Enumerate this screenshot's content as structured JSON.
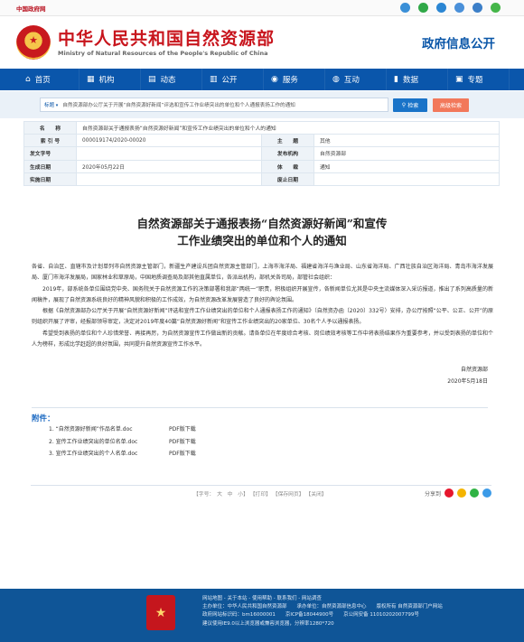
{
  "topbar": {
    "gov_link": "中国政府网",
    "icons": [
      {
        "name": "weibo-icon",
        "color": "#3a8fd7"
      },
      {
        "name": "wechat-icon",
        "color": "#30a848"
      },
      {
        "name": "app-icon",
        "color": "#2b86d3"
      },
      {
        "name": "mail-icon",
        "color": "#4a90d9"
      },
      {
        "name": "search-icon",
        "color": "#3c7fc8"
      },
      {
        "name": "message-icon",
        "color": "#45b649"
      }
    ]
  },
  "header": {
    "title_cn": "中华人民共和国自然资源部",
    "title_en": "Ministry of Natural Resources of the People's Republic of China",
    "section": "政府信息公开"
  },
  "nav": [
    {
      "icon": "home-icon",
      "glyph": "⌂",
      "label": "首页"
    },
    {
      "icon": "building-icon",
      "glyph": "▦",
      "label": "机构"
    },
    {
      "icon": "news-icon",
      "glyph": "▤",
      "label": "动态"
    },
    {
      "icon": "document-icon",
      "glyph": "▥",
      "label": "公开"
    },
    {
      "icon": "service-icon",
      "glyph": "◉",
      "label": "服务"
    },
    {
      "icon": "interact-icon",
      "glyph": "◍",
      "label": "互动"
    },
    {
      "icon": "data-icon",
      "glyph": "▮",
      "label": "数据"
    },
    {
      "icon": "topic-icon",
      "glyph": "▣",
      "label": "专题"
    }
  ],
  "search": {
    "scope": "标题",
    "query": "自然资源部办公厅关于开展“自然资源好新闻”评选和宣传工作业绩突出的单位和个人通报表扬工作的通知",
    "search_label": "检索",
    "advanced_label": "高级检索"
  },
  "info": {
    "name_label": "名　　称",
    "name_value": "自然资源部关于通报表扬“自然资源好新闻”和宣传工作业绩突出的单位和个人的通知",
    "index_label": "索 引 号",
    "index_value": "000019174/2020-00020",
    "topic_label": "主　　题",
    "topic_value": "其他",
    "doc_no_label": "发文字号",
    "doc_no_value": "",
    "issuer_label": "发布机构",
    "issuer_value": "自然资源部",
    "date_label": "生成日期",
    "date_value": "2020年05月22日",
    "genre_label": "体　　裁",
    "genre_value": "通知",
    "effective_label": "实施日期",
    "effective_value": "",
    "expiry_label": "废止日期",
    "expiry_value": ""
  },
  "article": {
    "title_line1": "自然资源部关于通报表扬“自然资源好新闻”和宣传",
    "title_line2": "工作业绩突出的单位和个人的通知",
    "salutation": "各省、自治区、直辖市及计划单列市自然资源主管部门，新疆生产建设兵团自然资源主管部门，上海市海洋局、福建省海洋与渔业局、山东省海洋局、广西壮族自治区海洋局、青岛市海洋发展局、厦门市海洋发展局，国家林业和草原局，中国地质调查局及部其他直属单位，各派出机构，部机关各司局，部管社会组织：",
    "para1": "2019年，部系统各单位围绕党中央、国务院关于自然资源工作的决策部署和我部“两统一”职责，积极组织开展宣传，各新闻单位尤其是中央主流媒体深入采访报道，推出了系列高质量的新闻稿件，展现了自然资源系统良好的精神风貌和积极的工作成效，为自然资源改革发展营造了良好的舆论氛围。",
    "para2": "根据《自然资源部办公厅关于开展“自然资源好新闻”评选和宣传工作业绩突出的单位和个人通报表扬工作的通知》（自然资办函〔2020〕332号）安排，办公厅按照“公平、公正、公开”的原则组织开展了评审，经报部领导审定，决定对2019年度40篇“自然资源好新闻”和宣传工作业绩突出的20家单位、30名个人予以通报表扬。",
    "para3": "希望受到表扬的单位和个人珍惜荣誉、再接再厉，为自然资源宣传工作做出新的贡献。请各单位在年度综合考核、岗位绩效考核等工作中将表扬结果作为重要参考，并以受到表扬的单位和个人为榜样，形成比学赶超的良好氛围，共同提升自然资源宣传工作水平。",
    "signer": "自然资源部",
    "sign_date": "2020年5月18日"
  },
  "attachments": {
    "heading": "附件：",
    "items": [
      {
        "name": "1. “自然资源好新闻”作品名单.doc",
        "pdf": "PDF版下载"
      },
      {
        "name": "2. 宣传工作业绩突出的单位名单.doc",
        "pdf": "PDF版下载"
      },
      {
        "name": "3. 宣传工作业绩突出的个人名单.doc",
        "pdf": "PDF版下载"
      }
    ]
  },
  "tools": {
    "font_size": "【字号：　大　中　小】",
    "print": "【打印】",
    "save_page": "【保存网页】",
    "close": "【关闭】",
    "share_label": "分享到",
    "share_icons": [
      {
        "name": "weibo-share-icon",
        "color": "#e6162d"
      },
      {
        "name": "qzone-share-icon",
        "color": "#f4b400"
      },
      {
        "name": "wechat-share-icon",
        "color": "#2fb344"
      },
      {
        "name": "qq-share-icon",
        "color": "#3c9be8"
      }
    ]
  },
  "footer": {
    "links": "网站地图 - 关于本站 - 使用帮助 - 联系我们 - 网站调查",
    "host": "主办单位：中华人民共和国自然资源部　　承办单位：自然资源部信息中心　　版权所有 自然资源部门户网站",
    "ids": "政府网站标识码：bm16000001　　京ICP备18044900号　　京公网安备 11010202007799号",
    "browser": "建议使用IE9.0以上浏览器或兼容浏览器，分辨率1280*720"
  }
}
